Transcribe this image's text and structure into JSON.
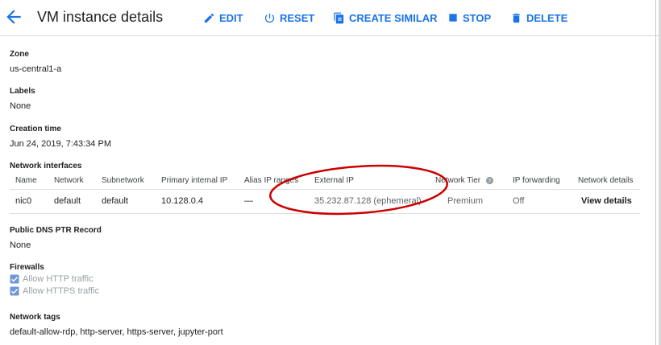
{
  "header": {
    "title": "VM instance details",
    "edit_label": "EDIT",
    "reset_label": "RESET",
    "create_similar_label": "CREATE SIMILAR",
    "stop_label": "STOP",
    "delete_label": "DELETE",
    "accent_color": "#1a73e8"
  },
  "details": {
    "zone_label": "Zone",
    "zone_value": "us-central1-a",
    "labels_label": "Labels",
    "labels_value": "None",
    "creation_label": "Creation time",
    "creation_value": "Jun 24, 2019, 7:43:34 PM"
  },
  "network": {
    "section_label": "Network interfaces",
    "columns": [
      "Name",
      "Network",
      "Subnetwork",
      "Primary internal IP",
      "Alias IP ranges",
      "External IP",
      "Network Tier",
      "IP forwarding",
      "Network details"
    ],
    "row": {
      "name": "nic0",
      "network": "default",
      "subnetwork": "default",
      "primary_ip": "10.128.0.4",
      "alias_ip": "—",
      "external_ip": "35.232.87.128 (ephemeral)",
      "tier": "Premium",
      "ip_forwarding": "Off",
      "details_link": "View details"
    }
  },
  "dns": {
    "label": "Public DNS PTR Record",
    "value": "None"
  },
  "firewalls": {
    "label": "Firewalls",
    "http": "Allow HTTP traffic",
    "https": "Allow HTTPS traffic"
  },
  "tags": {
    "label": "Network tags",
    "value": "default-allow-rdp, http-server, https-server, jupyter-port"
  },
  "annotation": {
    "color": "#cc0000"
  }
}
